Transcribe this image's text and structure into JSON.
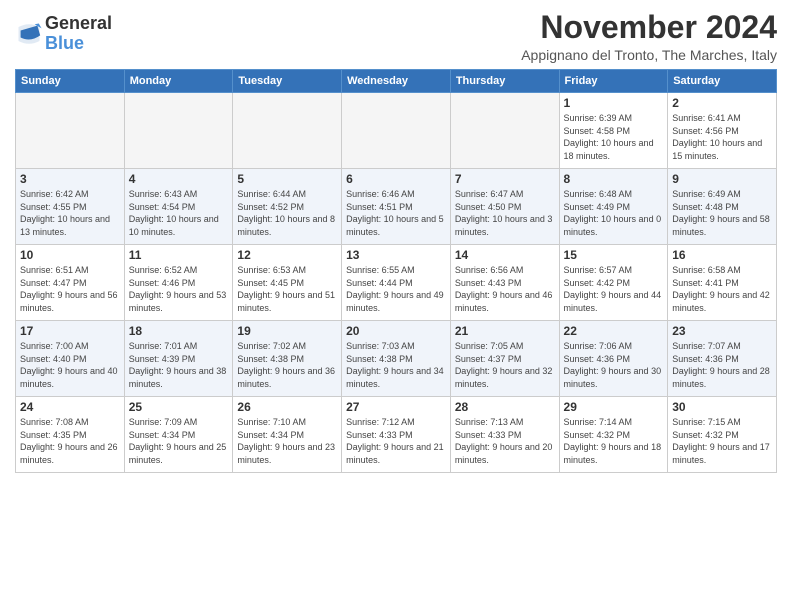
{
  "logo": {
    "line1": "General",
    "line2": "Blue"
  },
  "title": "November 2024",
  "location": "Appignano del Tronto, The Marches, Italy",
  "headers": [
    "Sunday",
    "Monday",
    "Tuesday",
    "Wednesday",
    "Thursday",
    "Friday",
    "Saturday"
  ],
  "weeks": [
    [
      {
        "day": "",
        "info": ""
      },
      {
        "day": "",
        "info": ""
      },
      {
        "day": "",
        "info": ""
      },
      {
        "day": "",
        "info": ""
      },
      {
        "day": "",
        "info": ""
      },
      {
        "day": "1",
        "info": "Sunrise: 6:39 AM\nSunset: 4:58 PM\nDaylight: 10 hours\nand 18 minutes."
      },
      {
        "day": "2",
        "info": "Sunrise: 6:41 AM\nSunset: 4:56 PM\nDaylight: 10 hours\nand 15 minutes."
      }
    ],
    [
      {
        "day": "3",
        "info": "Sunrise: 6:42 AM\nSunset: 4:55 PM\nDaylight: 10 hours\nand 13 minutes."
      },
      {
        "day": "4",
        "info": "Sunrise: 6:43 AM\nSunset: 4:54 PM\nDaylight: 10 hours\nand 10 minutes."
      },
      {
        "day": "5",
        "info": "Sunrise: 6:44 AM\nSunset: 4:52 PM\nDaylight: 10 hours\nand 8 minutes."
      },
      {
        "day": "6",
        "info": "Sunrise: 6:46 AM\nSunset: 4:51 PM\nDaylight: 10 hours\nand 5 minutes."
      },
      {
        "day": "7",
        "info": "Sunrise: 6:47 AM\nSunset: 4:50 PM\nDaylight: 10 hours\nand 3 minutes."
      },
      {
        "day": "8",
        "info": "Sunrise: 6:48 AM\nSunset: 4:49 PM\nDaylight: 10 hours\nand 0 minutes."
      },
      {
        "day": "9",
        "info": "Sunrise: 6:49 AM\nSunset: 4:48 PM\nDaylight: 9 hours\nand 58 minutes."
      }
    ],
    [
      {
        "day": "10",
        "info": "Sunrise: 6:51 AM\nSunset: 4:47 PM\nDaylight: 9 hours\nand 56 minutes."
      },
      {
        "day": "11",
        "info": "Sunrise: 6:52 AM\nSunset: 4:46 PM\nDaylight: 9 hours\nand 53 minutes."
      },
      {
        "day": "12",
        "info": "Sunrise: 6:53 AM\nSunset: 4:45 PM\nDaylight: 9 hours\nand 51 minutes."
      },
      {
        "day": "13",
        "info": "Sunrise: 6:55 AM\nSunset: 4:44 PM\nDaylight: 9 hours\nand 49 minutes."
      },
      {
        "day": "14",
        "info": "Sunrise: 6:56 AM\nSunset: 4:43 PM\nDaylight: 9 hours\nand 46 minutes."
      },
      {
        "day": "15",
        "info": "Sunrise: 6:57 AM\nSunset: 4:42 PM\nDaylight: 9 hours\nand 44 minutes."
      },
      {
        "day": "16",
        "info": "Sunrise: 6:58 AM\nSunset: 4:41 PM\nDaylight: 9 hours\nand 42 minutes."
      }
    ],
    [
      {
        "day": "17",
        "info": "Sunrise: 7:00 AM\nSunset: 4:40 PM\nDaylight: 9 hours\nand 40 minutes."
      },
      {
        "day": "18",
        "info": "Sunrise: 7:01 AM\nSunset: 4:39 PM\nDaylight: 9 hours\nand 38 minutes."
      },
      {
        "day": "19",
        "info": "Sunrise: 7:02 AM\nSunset: 4:38 PM\nDaylight: 9 hours\nand 36 minutes."
      },
      {
        "day": "20",
        "info": "Sunrise: 7:03 AM\nSunset: 4:38 PM\nDaylight: 9 hours\nand 34 minutes."
      },
      {
        "day": "21",
        "info": "Sunrise: 7:05 AM\nSunset: 4:37 PM\nDaylight: 9 hours\nand 32 minutes."
      },
      {
        "day": "22",
        "info": "Sunrise: 7:06 AM\nSunset: 4:36 PM\nDaylight: 9 hours\nand 30 minutes."
      },
      {
        "day": "23",
        "info": "Sunrise: 7:07 AM\nSunset: 4:36 PM\nDaylight: 9 hours\nand 28 minutes."
      }
    ],
    [
      {
        "day": "24",
        "info": "Sunrise: 7:08 AM\nSunset: 4:35 PM\nDaylight: 9 hours\nand 26 minutes."
      },
      {
        "day": "25",
        "info": "Sunrise: 7:09 AM\nSunset: 4:34 PM\nDaylight: 9 hours\nand 25 minutes."
      },
      {
        "day": "26",
        "info": "Sunrise: 7:10 AM\nSunset: 4:34 PM\nDaylight: 9 hours\nand 23 minutes."
      },
      {
        "day": "27",
        "info": "Sunrise: 7:12 AM\nSunset: 4:33 PM\nDaylight: 9 hours\nand 21 minutes."
      },
      {
        "day": "28",
        "info": "Sunrise: 7:13 AM\nSunset: 4:33 PM\nDaylight: 9 hours\nand 20 minutes."
      },
      {
        "day": "29",
        "info": "Sunrise: 7:14 AM\nSunset: 4:32 PM\nDaylight: 9 hours\nand 18 minutes."
      },
      {
        "day": "30",
        "info": "Sunrise: 7:15 AM\nSunset: 4:32 PM\nDaylight: 9 hours\nand 17 minutes."
      }
    ]
  ]
}
